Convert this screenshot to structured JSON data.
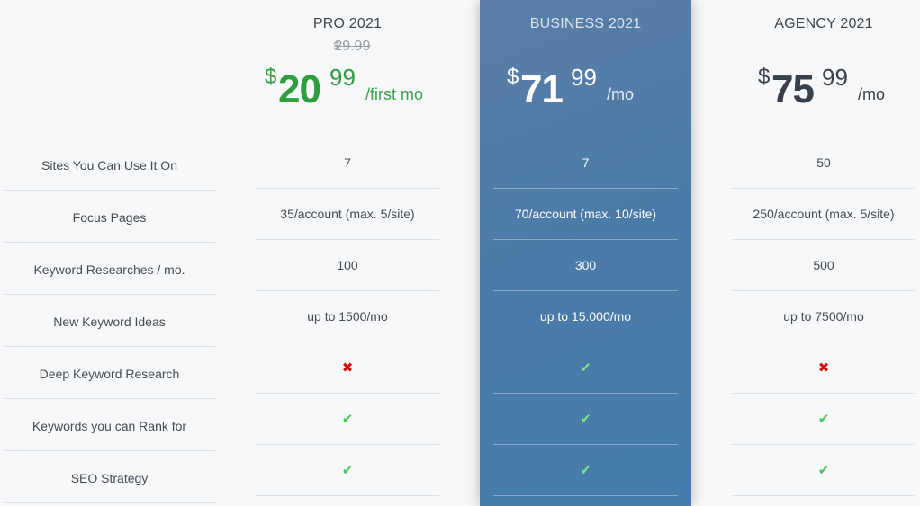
{
  "features": [
    "Sites You Can Use It On",
    "Focus Pages",
    "Keyword Researches / mo.",
    "New Keyword Ideas",
    "Deep Keyword Research",
    "Keywords you can Rank for",
    "SEO Strategy"
  ],
  "plans": [
    {
      "name": "PRO 2021",
      "old_price": {
        "currency": "$",
        "amount": "29.99"
      },
      "price": {
        "currency": "$",
        "whole": "20",
        "cents": "99",
        "period": "/first mo"
      },
      "values": [
        "7",
        "35/account (max. 5/site)",
        "100",
        "up to 1500/mo"
      ],
      "icons": [
        "cross",
        "check",
        "check"
      ],
      "accent_color": "#2e9e3e"
    },
    {
      "name": "BUSINESS 2021",
      "price": {
        "currency": "$",
        "whole": "71",
        "cents": "99",
        "period": "/mo"
      },
      "values": [
        "7",
        "70/account (max. 10/site)",
        "300",
        "up to 15.000/mo"
      ],
      "icons": [
        "check",
        "check",
        "check"
      ],
      "highlighted": true,
      "accent_color": "#4a7aa8"
    },
    {
      "name": "AGENCY 2021",
      "price": {
        "currency": "$",
        "whole": "75",
        "cents": "99",
        "period": "/mo"
      },
      "values": [
        "50",
        "250/account (max. 5/site)",
        "500",
        "up to 7500/mo"
      ],
      "icons": [
        "cross",
        "check",
        "check"
      ],
      "accent_color": "#38404c"
    }
  ],
  "icon_glyphs": {
    "check": "✔",
    "cross": "✖"
  },
  "colors": {
    "check": "#46c65a",
    "cross": "#cc1111",
    "highlight_bg": "#4a7aa8"
  }
}
